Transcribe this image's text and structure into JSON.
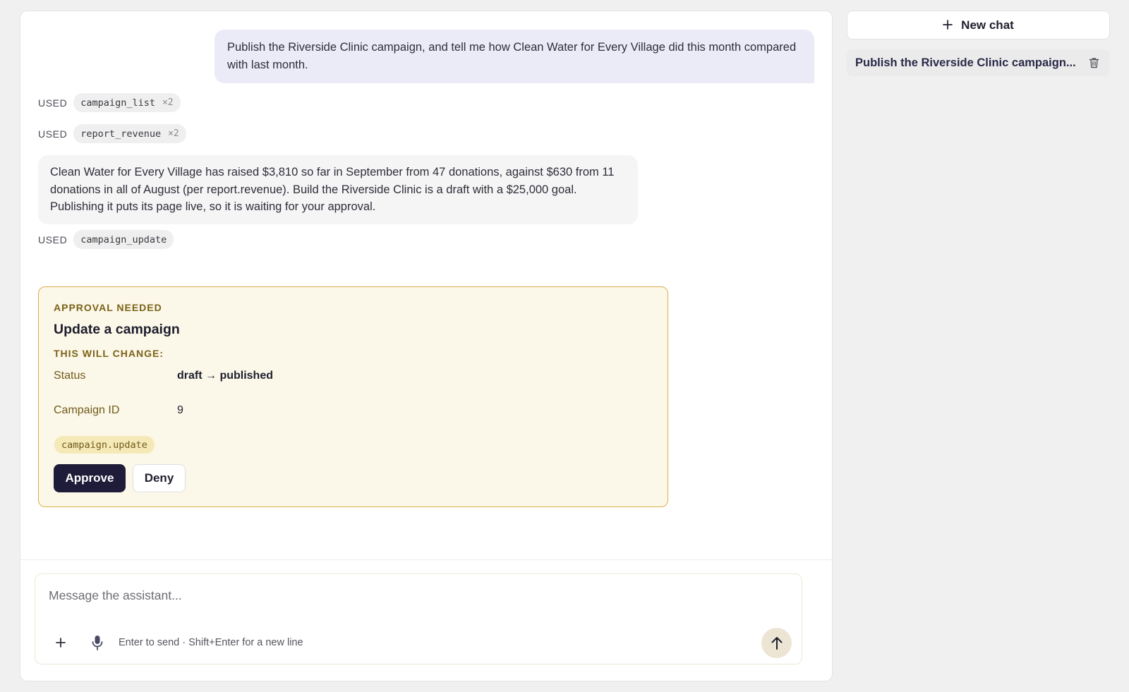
{
  "conversation": {
    "user_message": "Publish the Riverside Clinic campaign, and tell me how Clean Water for Every Village did this month compared with last month.",
    "tool_usages": [
      {
        "label": "USED",
        "tool": "campaign_list",
        "count": "×2"
      },
      {
        "label": "USED",
        "tool": "report_revenue",
        "count": "×2"
      },
      {
        "label": "USED",
        "tool": "campaign_update",
        "count": ""
      }
    ],
    "assistant_message": "Clean Water for Every Village has raised $3,810 so far in September from 47 donations, against $630 from 11 donations in all of August (per report.revenue). Build the Riverside Clinic is a draft with a $25,000 goal. Publishing it puts its page live, so it is waiting for your approval."
  },
  "approval": {
    "kicker": "APPROVAL NEEDED",
    "title": "Update a campaign",
    "changes_heading": "THIS WILL CHANGE:",
    "changes": [
      {
        "key": "Status",
        "value": "draft → published"
      },
      {
        "key": "Campaign ID",
        "value": "9"
      }
    ],
    "permission": "campaign.update",
    "approve_label": "Approve",
    "deny_label": "Deny"
  },
  "composer": {
    "placeholder": "Message the assistant...",
    "hint": "Enter to send · Shift+Enter for a new line",
    "attach_icon": "plus-icon",
    "mic_icon": "microphone-icon",
    "send_icon": "arrow-up-icon"
  },
  "sidebar": {
    "new_chat_label": "New chat",
    "history": [
      {
        "title": "Publish the Riverside Clinic campaign...",
        "delete_icon": "trash-icon"
      }
    ]
  },
  "colors": {
    "user_bubble": "#ebeaf7",
    "approval_bg": "#fcf8e9",
    "approval_border": "#dcae4a",
    "approve_button": "#1f1c3a",
    "send_button": "#ede5d4"
  }
}
